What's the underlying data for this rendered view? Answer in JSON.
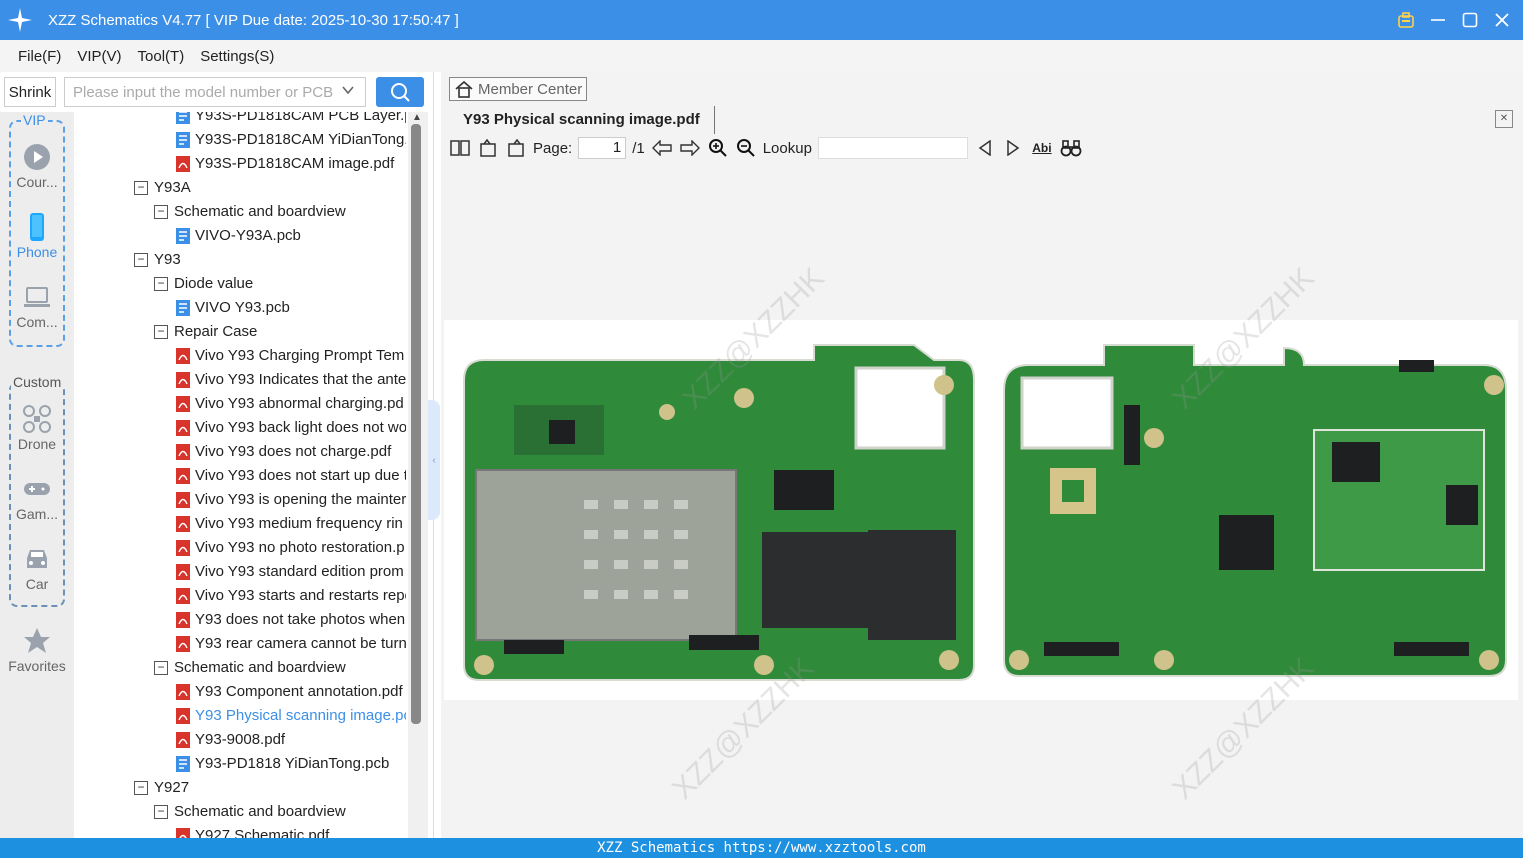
{
  "app": {
    "title": "XZZ Schematics V4.77 [ VIP Due date: 2025-10-30 17:50:47 ]"
  },
  "menu": [
    "File(F)",
    "VIP(V)",
    "Tool(T)",
    "Settings(S)"
  ],
  "search": {
    "shrink_label": "Shrink",
    "placeholder": "Please input the model number or PCB"
  },
  "categories": {
    "vip_label": "VIP",
    "custom_label": "Custom",
    "items": [
      {
        "label": "Cour...",
        "icon": "play-icon",
        "active": false
      },
      {
        "label": "Phone",
        "icon": "phone-icon",
        "active": true
      },
      {
        "label": "Com...",
        "icon": "laptop-icon",
        "active": false
      },
      {
        "label": "Drone",
        "icon": "drone-icon",
        "active": false
      },
      {
        "label": "Gam...",
        "icon": "gamepad-icon",
        "active": false
      },
      {
        "label": "Car",
        "icon": "car-icon",
        "active": false
      }
    ],
    "favorites_label": "Favorites"
  },
  "tree": [
    {
      "level": 2,
      "type": "pcb",
      "label": "Y93S-PD1818CAM PCB Layer.pc"
    },
    {
      "level": 2,
      "type": "pcb",
      "label": "Y93S-PD1818CAM YiDianTong.p"
    },
    {
      "level": 2,
      "type": "pdf",
      "label": "Y93S-PD1818CAM image.pdf"
    },
    {
      "level": 0,
      "type": "folder",
      "label": "Y93A"
    },
    {
      "level": 1,
      "type": "folder",
      "label": "Schematic and boardview"
    },
    {
      "level": 2,
      "type": "pcb",
      "label": "VIVO-Y93A.pcb"
    },
    {
      "level": 0,
      "type": "folder",
      "label": "Y93"
    },
    {
      "level": 1,
      "type": "folder",
      "label": "Diode value"
    },
    {
      "level": 2,
      "type": "pcb",
      "label": "VIVO Y93.pcb"
    },
    {
      "level": 1,
      "type": "folder",
      "label": "Repair Case"
    },
    {
      "level": 2,
      "type": "pdf",
      "label": "Vivo Y93 Charging Prompt Tem"
    },
    {
      "level": 2,
      "type": "pdf",
      "label": "Vivo Y93 Indicates that the ante"
    },
    {
      "level": 2,
      "type": "pdf",
      "label": "Vivo Y93 abnormal charging.pd"
    },
    {
      "level": 2,
      "type": "pdf",
      "label": "Vivo Y93 back light does not wo"
    },
    {
      "level": 2,
      "type": "pdf",
      "label": "Vivo Y93 does not charge.pdf"
    },
    {
      "level": 2,
      "type": "pdf",
      "label": "Vivo Y93 does not start up due t"
    },
    {
      "level": 2,
      "type": "pdf",
      "label": "Vivo Y93 is opening the mainter"
    },
    {
      "level": 2,
      "type": "pdf",
      "label": "Vivo Y93 medium frequency rin"
    },
    {
      "level": 2,
      "type": "pdf",
      "label": "Vivo Y93 no photo restoration.p"
    },
    {
      "level": 2,
      "type": "pdf",
      "label": "Vivo Y93 standard edition prom"
    },
    {
      "level": 2,
      "type": "pdf",
      "label": "Vivo Y93 starts and restarts repe"
    },
    {
      "level": 2,
      "type": "pdf",
      "label": "Y93 does not take photos when"
    },
    {
      "level": 2,
      "type": "pdf",
      "label": "Y93 rear camera cannot be turn"
    },
    {
      "level": 1,
      "type": "folder",
      "label": "Schematic and boardview"
    },
    {
      "level": 2,
      "type": "pdf",
      "label": "Y93 Component annotation.pdf"
    },
    {
      "level": 2,
      "type": "pdf",
      "label": "Y93 Physical scanning image.pc",
      "selected": true
    },
    {
      "level": 2,
      "type": "pdf",
      "label": "Y93-9008.pdf"
    },
    {
      "level": 2,
      "type": "pcb",
      "label": "Y93-PD1818 YiDianTong.pcb"
    },
    {
      "level": 0,
      "type": "folder",
      "label": "Y927"
    },
    {
      "level": 1,
      "type": "folder",
      "label": "Schematic and boardview"
    },
    {
      "level": 2,
      "type": "pdf",
      "label": "Y927 Schematic.pdf"
    }
  ],
  "viewer": {
    "member_center": "Member Center",
    "tab_title": "Y93 Physical scanning image.pdf",
    "page_label": "Page:",
    "page_current": "1",
    "page_total": "/1",
    "lookup_label": "Lookup",
    "abi_label": "Abi",
    "watermark": "XZZ@XZZHK"
  },
  "status": {
    "text": "XZZ Schematics https://www.xzztools.com"
  },
  "colors": {
    "accent": "#3b8fe6",
    "pcb_green": "#2f8a3a",
    "pdf_red": "#d9342b"
  }
}
